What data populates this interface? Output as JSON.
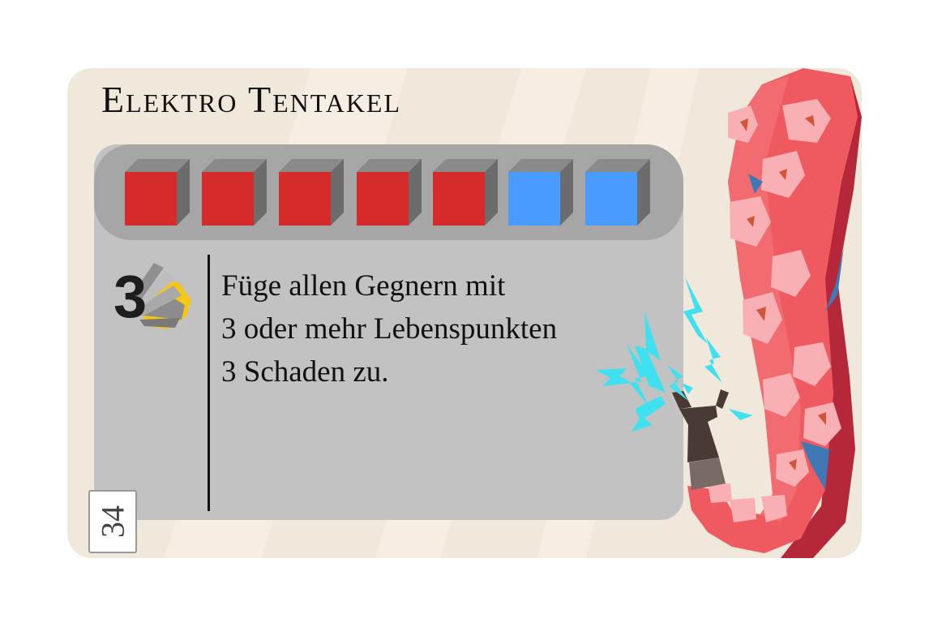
{
  "card": {
    "title": "Elektro Tentakel",
    "number": "34",
    "cost_cubes": [
      "red",
      "red",
      "red",
      "red",
      "red",
      "blue",
      "blue"
    ],
    "colors": {
      "red": "#d62b2b",
      "blue": "#4a9bff",
      "cube_side": "#6c6c6c",
      "cube_top": "#8a8a8a",
      "tentacle": "#ee5a60",
      "tentacle_dark": "#b5283a",
      "sucker": "#f8b0b4",
      "lightning": "#3fe0f0",
      "energy_yellow": "#f5c612"
    },
    "effect": {
      "value": "3",
      "icon": "explosion-burst-icon",
      "lines": [
        "Füge allen Gegnern mit",
        "3 oder mehr Lebenspunkten",
        "3 Schaden zu."
      ]
    }
  }
}
